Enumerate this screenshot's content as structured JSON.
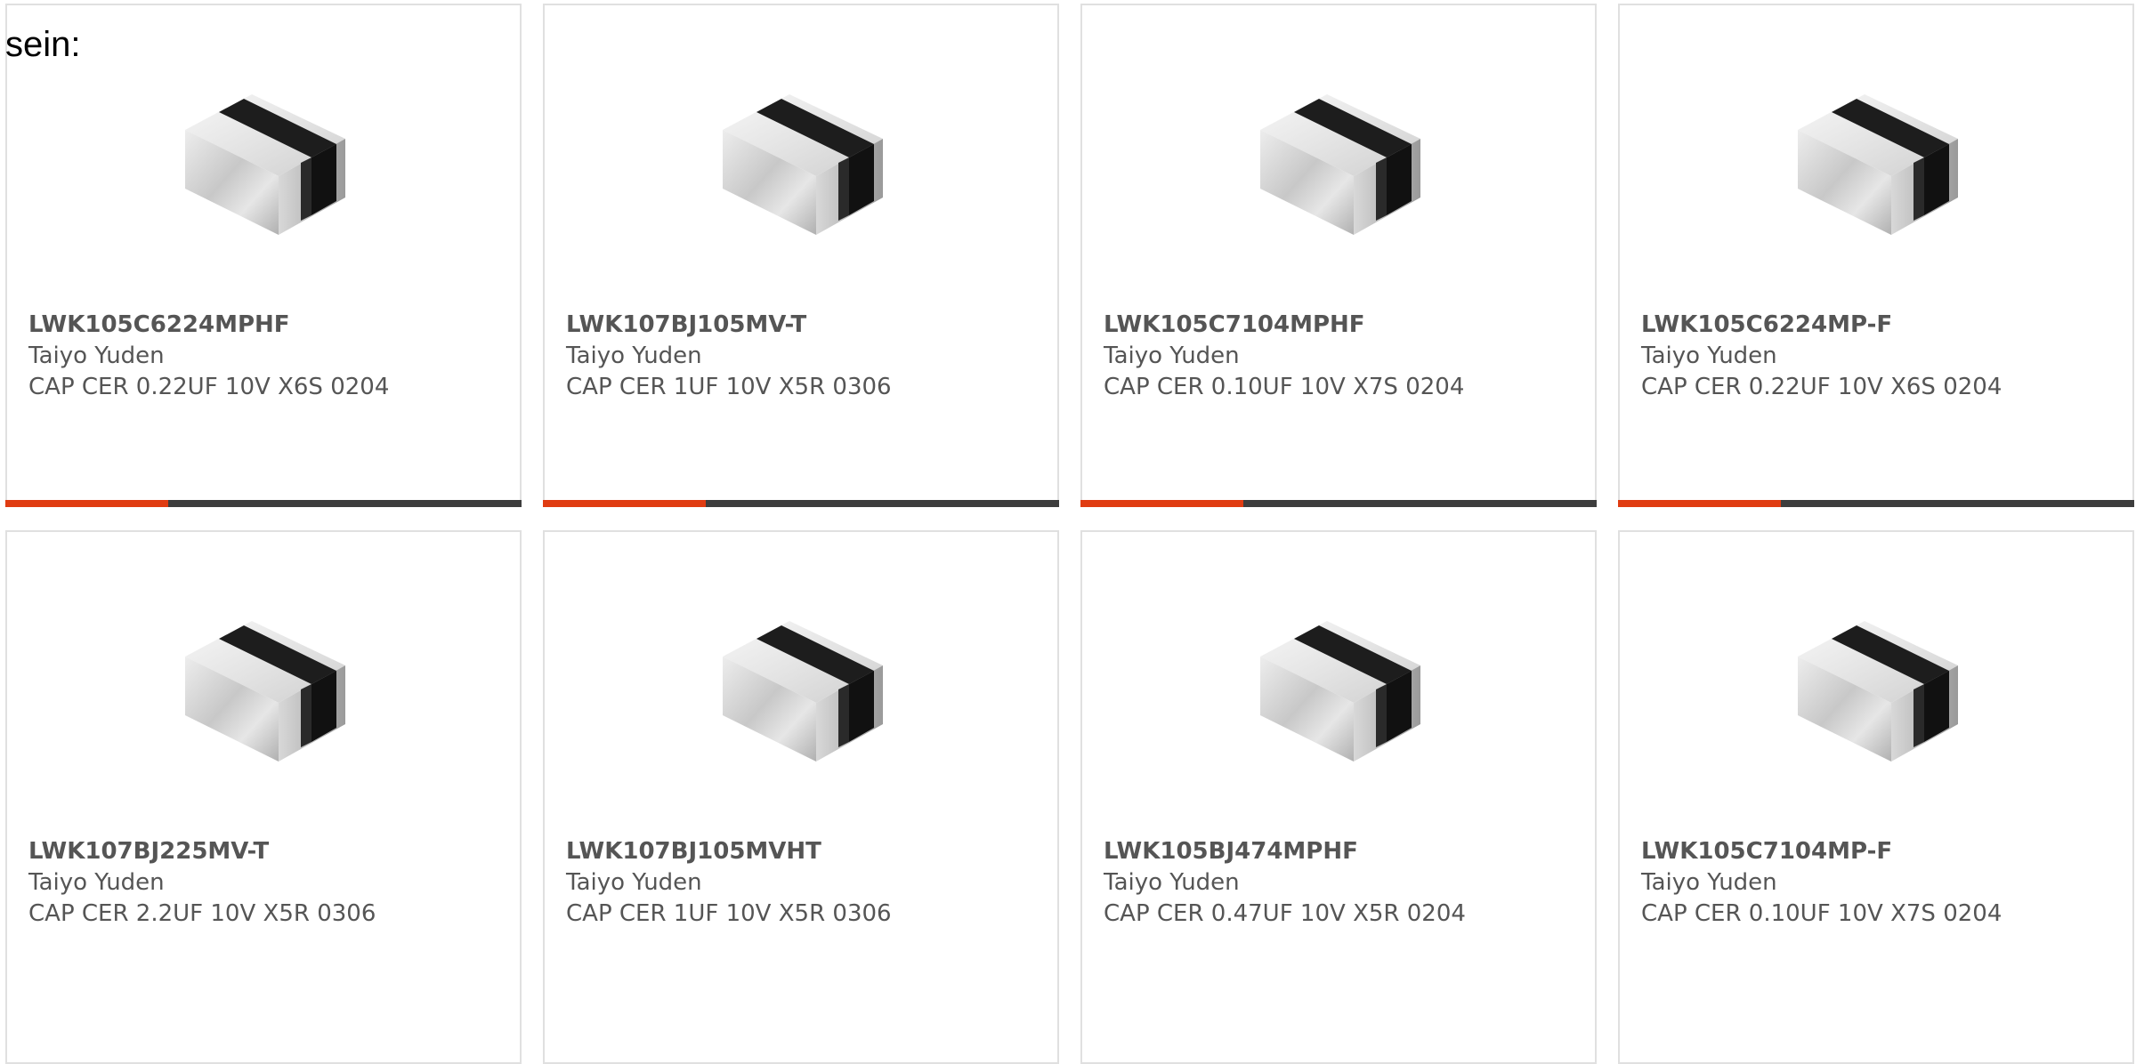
{
  "page": {
    "heading_fragment": "sein:"
  },
  "colors": {
    "accent": "#e03c12",
    "bar": "#3d3d3d",
    "card_border": "#e0e0e0",
    "text": "#555555"
  },
  "products": [
    {
      "part_number": "LWK105C6224MPHF",
      "manufacturer": "Taiyo Yuden",
      "description": "CAP CER 0.22UF 10V X6S 0204",
      "image_icon": "ceramic-capacitor-image",
      "bar_fill": 0.315
    },
    {
      "part_number": "LWK107BJ105MV-T",
      "manufacturer": "Taiyo Yuden",
      "description": "CAP CER 1UF 10V X5R 0306",
      "image_icon": "ceramic-capacitor-image",
      "bar_fill": 0.315
    },
    {
      "part_number": "LWK105C7104MPHF",
      "manufacturer": "Taiyo Yuden",
      "description": "CAP CER 0.10UF 10V X7S 0204",
      "image_icon": "ceramic-capacitor-image",
      "bar_fill": 0.315
    },
    {
      "part_number": "LWK105C6224MP-F",
      "manufacturer": "Taiyo Yuden",
      "description": "CAP CER 0.22UF 10V X6S 0204",
      "image_icon": "ceramic-capacitor-image",
      "bar_fill": 0.315
    },
    {
      "part_number": "LWK107BJ225MV-T",
      "manufacturer": "Taiyo Yuden",
      "description": "CAP CER 2.2UF 10V X5R 0306",
      "image_icon": "ceramic-capacitor-image"
    },
    {
      "part_number": "LWK107BJ105MVHT",
      "manufacturer": "Taiyo Yuden",
      "description": "CAP CER 1UF 10V X5R 0306",
      "image_icon": "ceramic-capacitor-image"
    },
    {
      "part_number": "LWK105BJ474MPHF",
      "manufacturer": "Taiyo Yuden",
      "description": "CAP CER 0.47UF 10V X5R 0204",
      "image_icon": "ceramic-capacitor-image"
    },
    {
      "part_number": "LWK105C7104MP-F",
      "manufacturer": "Taiyo Yuden",
      "description": "CAP CER 0.10UF 10V X7S 0204",
      "image_icon": "ceramic-capacitor-image"
    }
  ]
}
